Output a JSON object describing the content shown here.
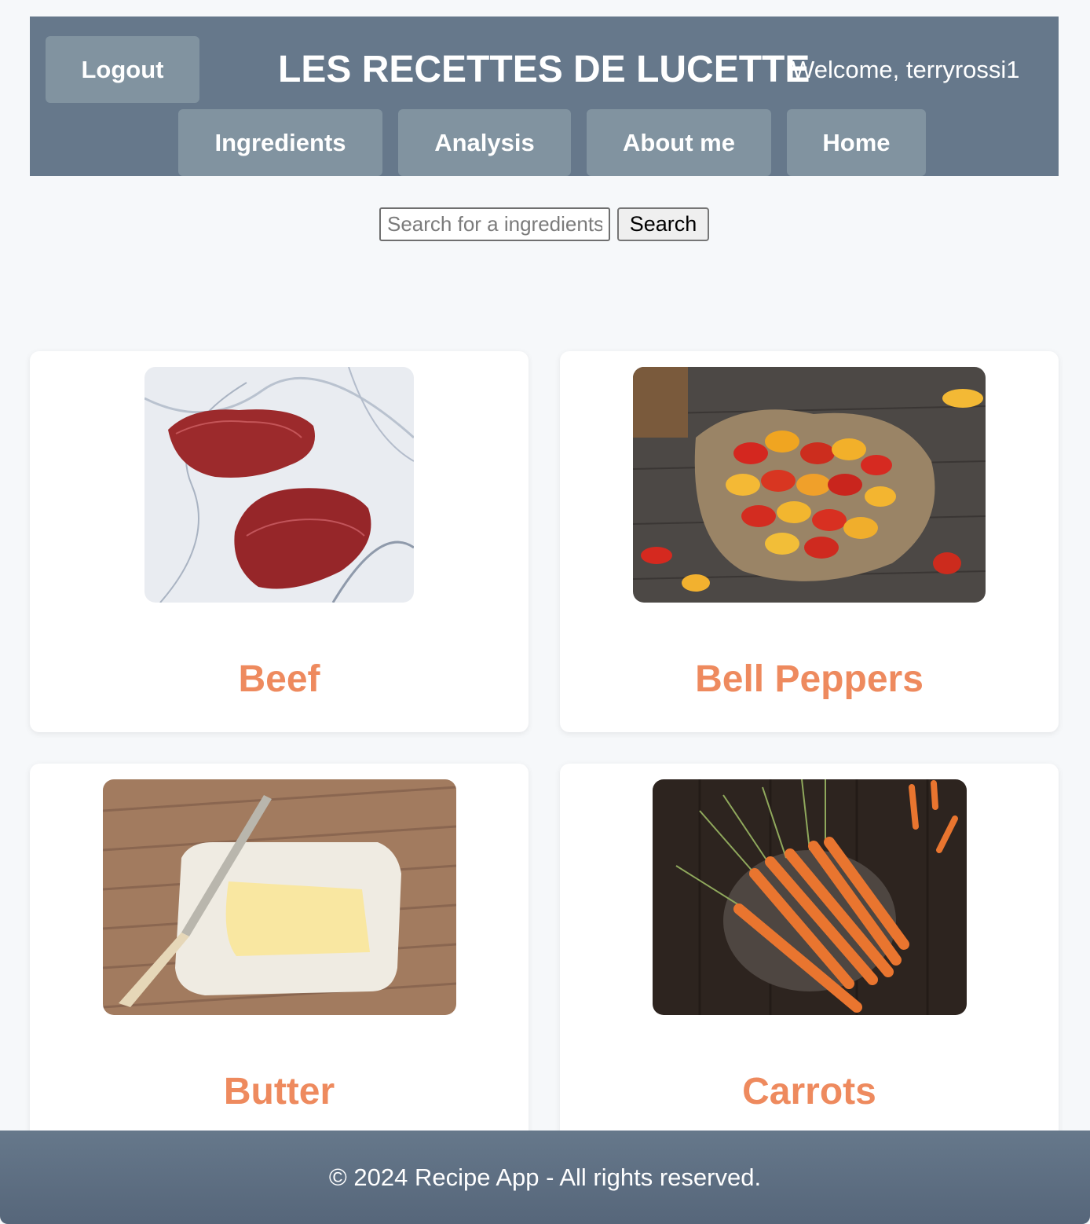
{
  "header": {
    "logout_label": "Logout",
    "title": "LES RECETTES DE LUCETTE",
    "welcome_text": "Welcome, terryrossi1",
    "nav": [
      {
        "label": "Ingredients"
      },
      {
        "label": "Analysis"
      },
      {
        "label": "About me"
      },
      {
        "label": "Home"
      }
    ]
  },
  "search": {
    "placeholder": "Search for a ingredients",
    "value": "",
    "button_label": "Search"
  },
  "ingredients": [
    {
      "name": "Beef"
    },
    {
      "name": "Bell Peppers"
    },
    {
      "name": "Butter"
    },
    {
      "name": "Carrots"
    }
  ],
  "footer": {
    "text": "© 2024 Recipe App - All rights reserved."
  },
  "colors": {
    "header_bg": "#66788b",
    "nav_button_bg": "#8193a0",
    "ingredient_title": "#ee8a5e",
    "page_bg": "#f6f8fa"
  }
}
